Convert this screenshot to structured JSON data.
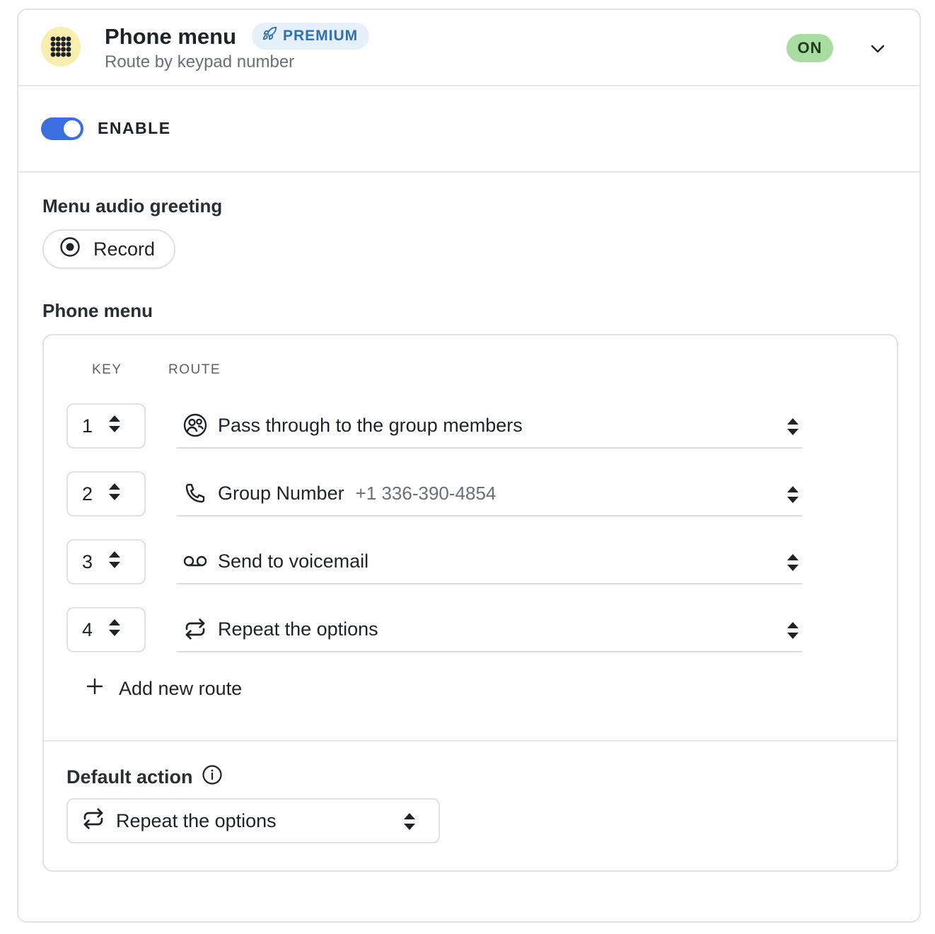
{
  "header": {
    "title": "Phone menu",
    "badge": "PREMIUM",
    "subtitle": "Route by keypad number",
    "status": "ON"
  },
  "enable": {
    "label": "ENABLE",
    "on": true
  },
  "greeting": {
    "label": "Menu audio greeting",
    "record_label": "Record"
  },
  "phone_menu": {
    "label": "Phone menu",
    "columns": {
      "key": "KEY",
      "route": "ROUTE"
    },
    "routes": [
      {
        "key": "1",
        "icon": "group-members-icon",
        "text": "Pass through to the group members",
        "sub": ""
      },
      {
        "key": "2",
        "icon": "phone-icon",
        "text": "Group Number",
        "sub": "+1 336-390-4854"
      },
      {
        "key": "3",
        "icon": "voicemail-icon",
        "text": "Send to voicemail",
        "sub": ""
      },
      {
        "key": "4",
        "icon": "repeat-icon",
        "text": "Repeat the options",
        "sub": ""
      }
    ],
    "add_route_label": "Add new route"
  },
  "default_action": {
    "label": "Default action",
    "value": "Repeat the options"
  },
  "colors": {
    "accent": "#3b6fe0",
    "premium_bg": "#e6f0fb",
    "premium_text": "#2f6fb3",
    "on_bg": "#a8dca0",
    "icon_bg": "#f8eeb0"
  }
}
